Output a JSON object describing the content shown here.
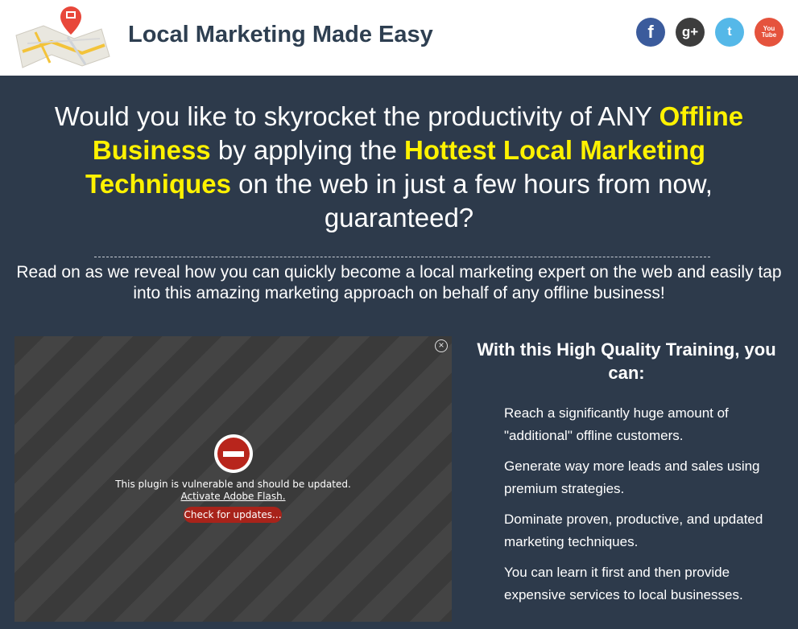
{
  "header": {
    "title": "Local Marketing Made Easy",
    "socials": [
      {
        "name": "facebook",
        "icon": "f",
        "color": "#3b5b9c"
      },
      {
        "name": "google-plus",
        "icon": "g+",
        "color": "#3d3d3d"
      },
      {
        "name": "twitter",
        "icon": "t",
        "color": "#55b8e8"
      },
      {
        "name": "youtube",
        "icon_top": "You",
        "icon_bottom": "Tube",
        "color": "#e5533d"
      }
    ]
  },
  "hero": {
    "headline_parts": [
      "Would you like to skyrocket the productivity of ANY ",
      "Offline Business",
      " by applying the ",
      "Hottest Local Marketing Techniques",
      " on the web in just a few hours from now, guaranteed?"
    ],
    "subheadline": "Read on as we reveal how you can quickly become a local marketing expert on the web and easily tap into this amazing marketing approach on behalf of any offline business!"
  },
  "plugin": {
    "message": "This plugin is vulnerable and should be updated.",
    "link": "Activate Adobe Flash.",
    "button": "Check for updates...",
    "close": "×"
  },
  "benefits": {
    "title": "With this High Quality Training, you can:",
    "items": [
      "Reach a significantly huge amount of \"additional\" offline customers.",
      "Generate way more leads and sales using premium strategies.",
      "Dominate proven, productive, and updated marketing techniques.",
      "You can learn it first and then provide expensive services to local businesses."
    ]
  },
  "colors": {
    "background": "#2d3a4b",
    "highlight": "#fff200",
    "title": "#2e3f51"
  }
}
